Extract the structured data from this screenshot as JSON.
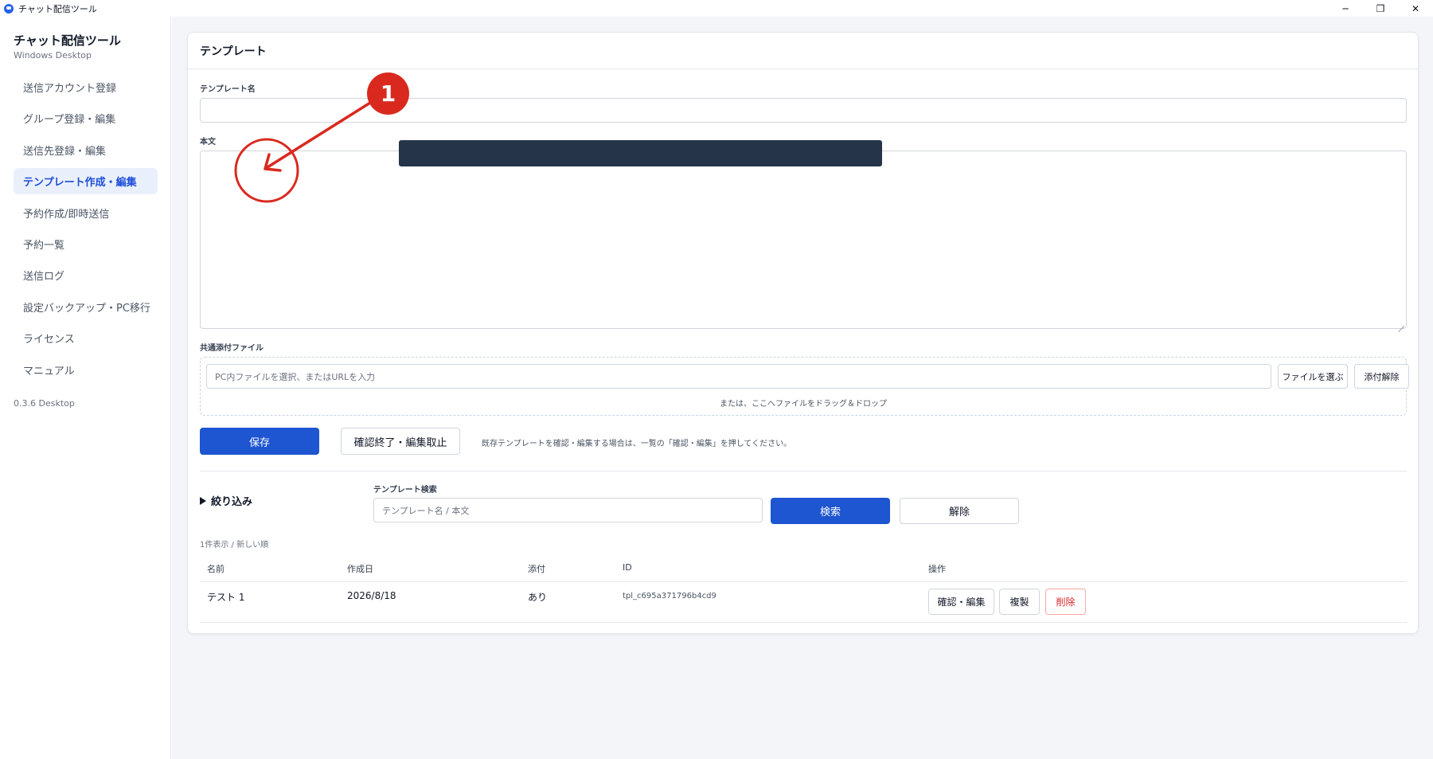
{
  "window": {
    "title": "チャット配信ツール",
    "minimize_glyph": "─",
    "restore_glyph": "❐",
    "close_glyph": "✕"
  },
  "sidebar": {
    "brand_title": "チャット配信ツール",
    "brand_subtitle": "Windows Desktop",
    "items": [
      {
        "label": "送信アカウント登録"
      },
      {
        "label": "グループ登録・編集"
      },
      {
        "label": "送信先登録・編集"
      },
      {
        "label": "テンプレート作成・編集",
        "active": true
      },
      {
        "label": "予約作成/即時送信"
      },
      {
        "label": "予約一覧"
      },
      {
        "label": "送信ログ"
      },
      {
        "label": "設定バックアップ・PC移行"
      },
      {
        "label": "ライセンス"
      },
      {
        "label": "マニュアル"
      }
    ],
    "version": "0.3.6 Desktop"
  },
  "template": {
    "header": "テンプレート",
    "name_label": "テンプレート名",
    "name_value": "",
    "body_label": "本文",
    "body_value": "",
    "attach_label": "共通添付ファイル",
    "attach_placeholder": "PC内ファイルを選択、またはURLを入力",
    "choose_file_label": "ファイルを選ぶ",
    "remove_attach_label": "添付解除",
    "drop_hint": "または、ここへファイルをドラッグ＆ドロップ",
    "save_label": "保存",
    "cancel_edit_label": "確認終了・編集取止",
    "help_text": "既存テンプレートを確認・編集する場合は、一覧の「確認・編集」を押してください。"
  },
  "filter": {
    "toggle_label": "絞り込み",
    "search_label": "テンプレート検索",
    "search_placeholder": "テンプレート名 / 本文",
    "search_button": "検索",
    "clear_button": "解除"
  },
  "list": {
    "count_text": "1件表示 / 新しい順",
    "columns": {
      "name": "名前",
      "created": "作成日",
      "attach": "添付",
      "id": "ID",
      "actions": "操作"
    },
    "rows": [
      {
        "name": "テスト 1",
        "created": "2026/8/18",
        "attach": "あり",
        "id": "tpl_c695a371796b4cd9",
        "edit_label": "確認・編集",
        "copy_label": "複製",
        "delete_label": "削除"
      }
    ]
  },
  "annotation": {
    "number": "1",
    "color": "#d9291f"
  },
  "colors": {
    "primary": "#1e55d0",
    "active_nav_bg": "#eaf0fb",
    "danger": "#dc2626",
    "redaction": "#253449"
  }
}
